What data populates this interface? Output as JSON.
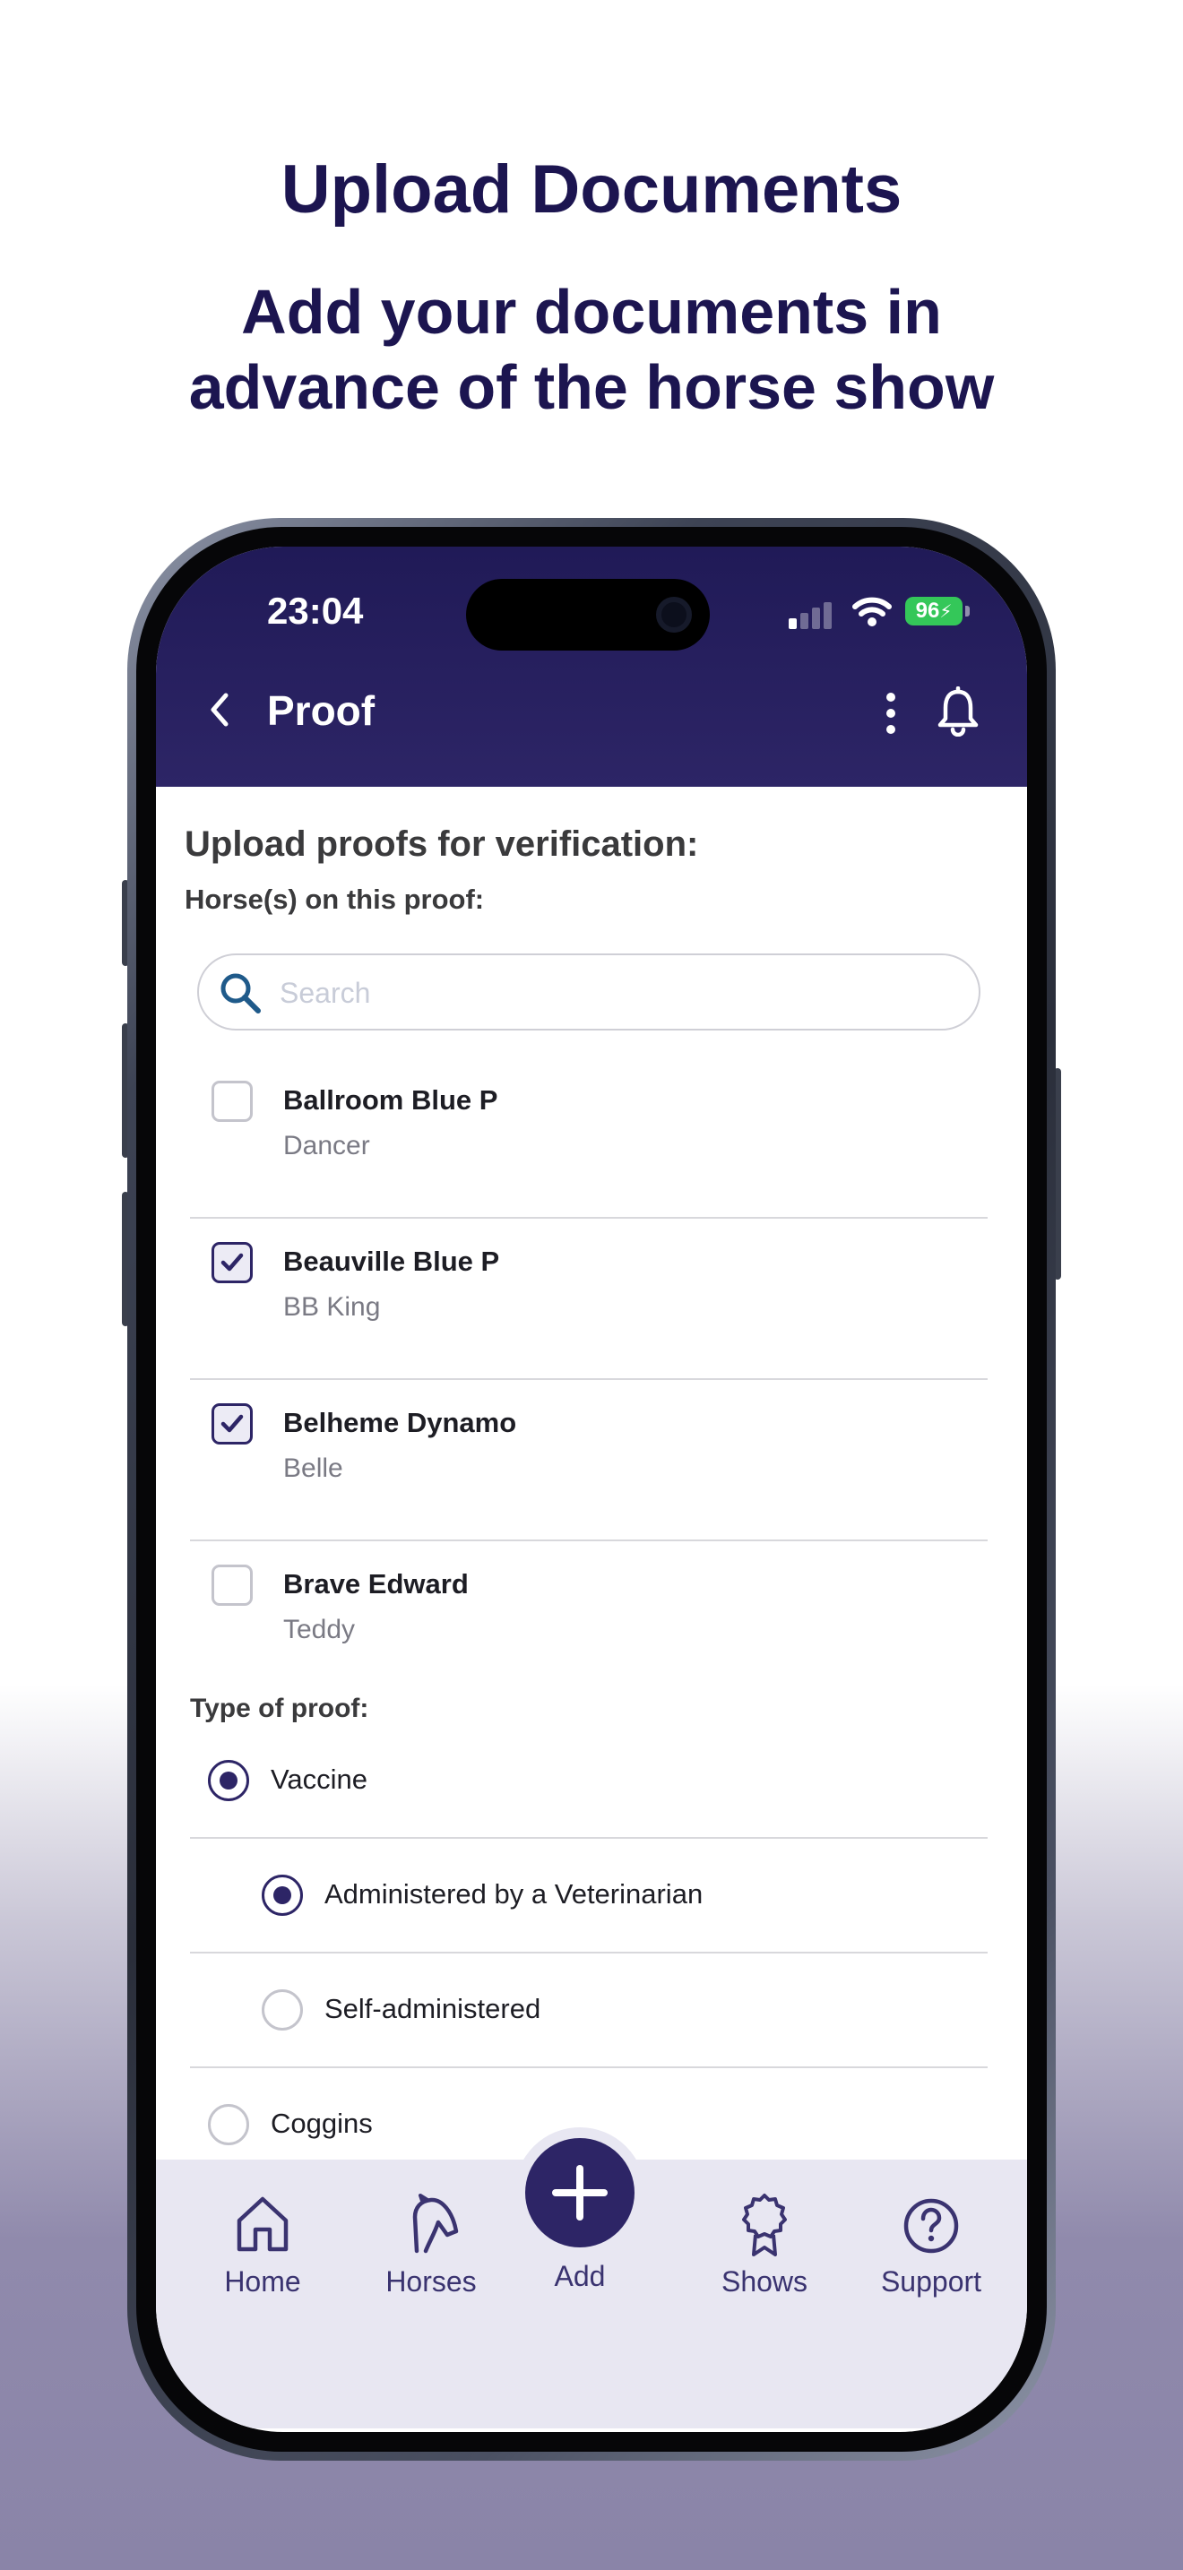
{
  "promo": {
    "title": "Upload Documents",
    "subtitle_line1": "Add your documents in",
    "subtitle_line2": "advance of the horse show"
  },
  "status_bar": {
    "time": "23:04",
    "battery": "96"
  },
  "header": {
    "title": "Proof",
    "icons": [
      "back-icon",
      "more-vertical-icon",
      "bell-icon"
    ]
  },
  "main": {
    "heading": "Upload proofs for verification:",
    "horses_label": "Horse(s) on this proof:",
    "search_placeholder": "Search",
    "horses": [
      {
        "name": "Ballroom Blue P",
        "nickname": "Dancer",
        "checked": false
      },
      {
        "name": "Beauville Blue P",
        "nickname": "BB King",
        "checked": true
      },
      {
        "name": "Belheme Dynamo",
        "nickname": "Belle",
        "checked": true
      },
      {
        "name": "Brave Edward",
        "nickname": "Teddy",
        "checked": false
      }
    ],
    "type_label": "Type of proof:",
    "proof_types": [
      {
        "label": "Vaccine",
        "selected": true
      },
      {
        "label": "Administered by a Veterinarian",
        "selected": true
      },
      {
        "label": "Self-administered",
        "selected": false
      },
      {
        "label": "Coggins",
        "selected": false
      }
    ]
  },
  "tabbar": {
    "home": "Home",
    "horses": "Horses",
    "add": "Add",
    "shows": "Shows",
    "support": "Support"
  },
  "colors": {
    "brand": "#2d2566",
    "headline": "#1c1550",
    "battery": "#34c759"
  }
}
